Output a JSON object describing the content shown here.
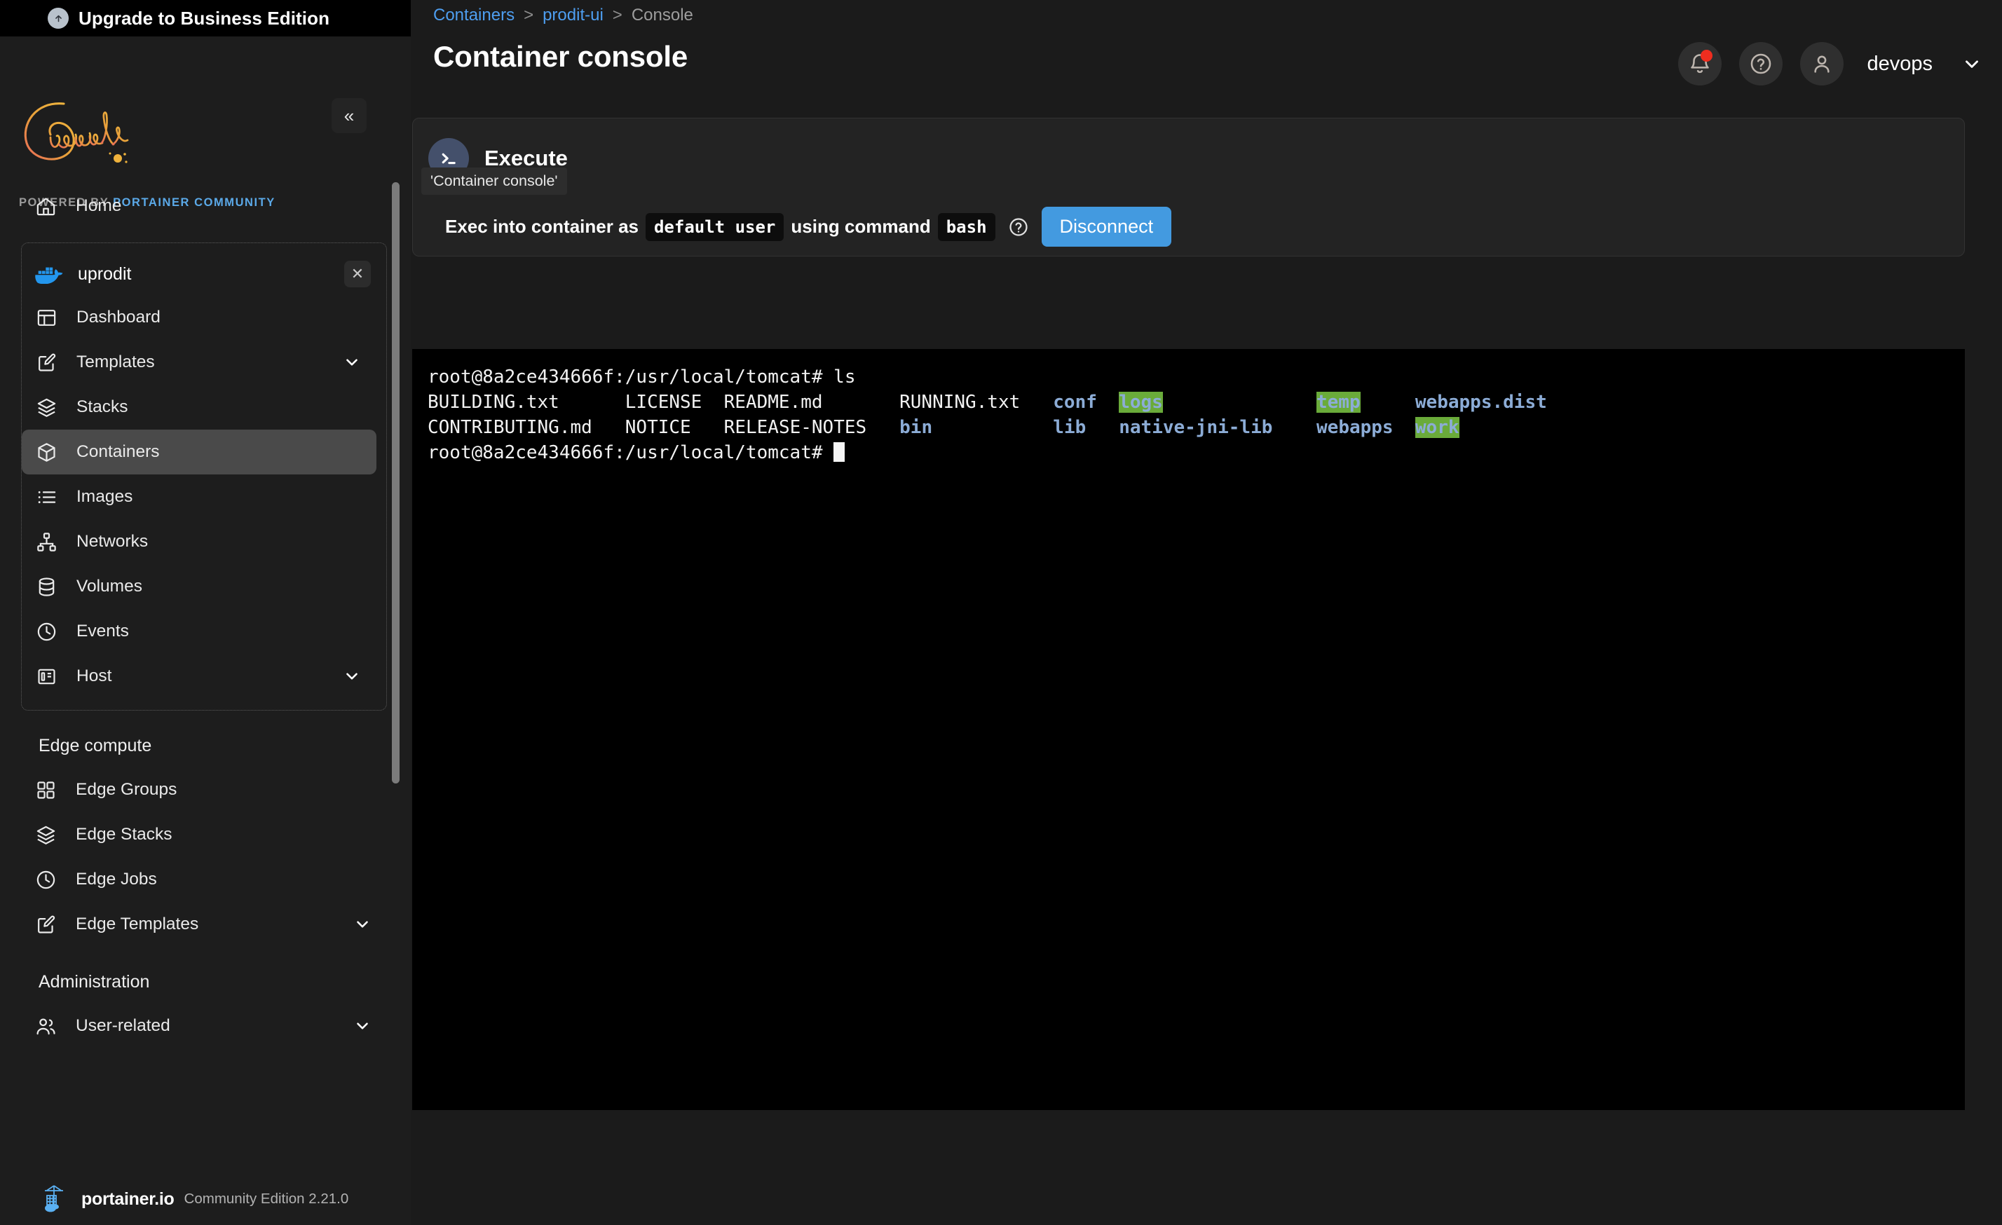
{
  "sidebar": {
    "upgrade": {
      "label": "Upgrade to Business Edition",
      "icon": "upgrade-arrow-icon"
    },
    "brand": {
      "script_name": "Comwork",
      "powered_prefix": "POWERED BY ",
      "powered_suffix": "PORTAINER COMMUNITY"
    },
    "collapse_label": "«",
    "home": {
      "label": "Home",
      "icon": "home-icon"
    },
    "environment": {
      "name": "uprodit",
      "icon": "docker-whale-icon",
      "close_label": "✕",
      "items": [
        {
          "label": "Dashboard",
          "icon": "dashboard-icon",
          "chevron": false,
          "active": false
        },
        {
          "label": "Templates",
          "icon": "templates-edit-icon",
          "chevron": true,
          "active": false
        },
        {
          "label": "Stacks",
          "icon": "stacks-layers-icon",
          "chevron": false,
          "active": false
        },
        {
          "label": "Containers",
          "icon": "container-cube-icon",
          "chevron": false,
          "active": true
        },
        {
          "label": "Images",
          "icon": "images-list-icon",
          "chevron": false,
          "active": false
        },
        {
          "label": "Networks",
          "icon": "networks-sitemap-icon",
          "chevron": false,
          "active": false
        },
        {
          "label": "Volumes",
          "icon": "volumes-database-icon",
          "chevron": false,
          "active": false
        },
        {
          "label": "Events",
          "icon": "events-clock-icon",
          "chevron": false,
          "active": false
        },
        {
          "label": "Host",
          "icon": "host-panel-icon",
          "chevron": true,
          "active": false
        }
      ]
    },
    "edge_section": {
      "title": "Edge compute",
      "items": [
        {
          "label": "Edge Groups",
          "icon": "edge-groups-grid-icon",
          "chevron": false
        },
        {
          "label": "Edge Stacks",
          "icon": "edge-stacks-layers-icon",
          "chevron": false
        },
        {
          "label": "Edge Jobs",
          "icon": "edge-jobs-clock-icon",
          "chevron": false
        },
        {
          "label": "Edge Templates",
          "icon": "edge-templates-edit-icon",
          "chevron": true
        }
      ]
    },
    "admin_section": {
      "title": "Administration",
      "items": [
        {
          "label": "User-related",
          "icon": "user-related-people-icon",
          "chevron": true
        }
      ]
    },
    "footer": {
      "name": "portainer.io",
      "version": "Community Edition 2.21.0",
      "icon": "portainer-crane-icon"
    }
  },
  "header": {
    "breadcrumb": [
      {
        "label": "Containers",
        "link": true
      },
      {
        "label": "prodit-ui",
        "link": true
      },
      {
        "label": "Console",
        "link": false
      }
    ],
    "breadcrumb_separator": ">",
    "page_title": "Container console",
    "notifications_icon": "bell-icon",
    "help_icon": "question-circle-icon",
    "avatar_icon": "user-avatar-icon",
    "user_name": "devops",
    "user_chevron_icon": "chevron-down-icon"
  },
  "exec_panel": {
    "avatar_icon": "terminal-prompt-icon",
    "title": "Execute",
    "tooltip": "'Container console'",
    "sentence_part1": "Exec into container as",
    "user_value": "default user",
    "sentence_part2": "using command",
    "command_value": "bash",
    "help_icon": "question-circle-icon",
    "disconnect_label": "Disconnect"
  },
  "terminal": {
    "prompt_line_1": "root@8a2ce434666f:/usr/local/tomcat# ls",
    "prompt_line_last": "root@8a2ce434666f:/usr/local/tomcat# ",
    "cursor": true,
    "listing_columns": [
      {
        "width": 18,
        "entries": [
          {
            "text": "BUILDING.txt",
            "style": "file"
          },
          {
            "text": "CONTRIBUTING.md",
            "style": "file"
          }
        ]
      },
      {
        "width": 9,
        "entries": [
          {
            "text": "LICENSE",
            "style": "file"
          },
          {
            "text": "NOTICE",
            "style": "file"
          }
        ]
      },
      {
        "width": 16,
        "entries": [
          {
            "text": "README.md",
            "style": "file"
          },
          {
            "text": "RELEASE-NOTES",
            "style": "file"
          }
        ]
      },
      {
        "width": 14,
        "entries": [
          {
            "text": "RUNNING.txt",
            "style": "file"
          },
          {
            "text": "bin",
            "style": "dir"
          }
        ]
      },
      {
        "width": 6,
        "entries": [
          {
            "text": "conf",
            "style": "dir"
          },
          {
            "text": "lib",
            "style": "dir"
          }
        ]
      },
      {
        "width": 18,
        "entries": [
          {
            "text": "logs",
            "style": "dir-sticky"
          },
          {
            "text": "native-jni-lib",
            "style": "dir"
          }
        ]
      },
      {
        "width": 9,
        "entries": [
          {
            "text": "temp",
            "style": "dir-sticky"
          },
          {
            "text": "webapps",
            "style": "dir"
          }
        ]
      },
      {
        "width": 14,
        "entries": [
          {
            "text": "webapps.dist",
            "style": "dir"
          },
          {
            "text": "work",
            "style": "dir-sticky"
          }
        ]
      }
    ]
  },
  "colors": {
    "accent_blue": "#439ae0",
    "link_blue": "#4e9ef0",
    "brand_blue": "#5ba9e8",
    "terminal_bg": "#000000",
    "terminal_fg": "#f2f2f2",
    "terminal_dir": "#8cacd6",
    "terminal_sticky_bg": "#6aab3a",
    "notification_dot": "#ef2d1f",
    "sidebar_bg": "#1d1d1d",
    "main_bg": "#1b1b1b"
  }
}
